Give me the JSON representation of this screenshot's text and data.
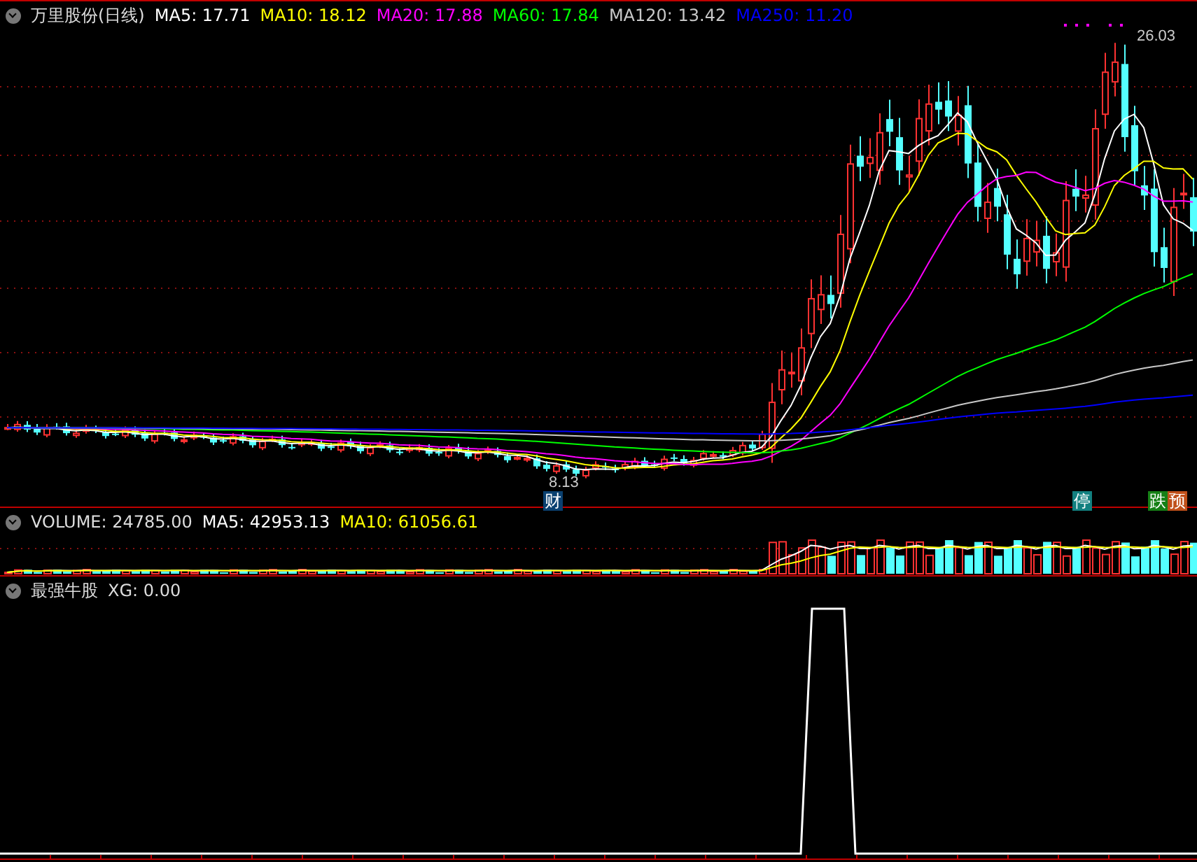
{
  "price_panel": {
    "title": "万里股份(日线)",
    "indicators": [
      {
        "label": "MA5: 17.71",
        "color": "#ffffff"
      },
      {
        "label": "MA10: 18.12",
        "color": "#ffff00"
      },
      {
        "label": "MA20: 17.88",
        "color": "#ff00ff"
      },
      {
        "label": "MA60: 17.84",
        "color": "#00ff00"
      },
      {
        "label": "MA120: 13.42",
        "color": "#c8c8c8"
      },
      {
        "label": "MA250: 11.20",
        "color": "#0000ff"
      }
    ],
    "high_label": "26.03",
    "low_label": "8.13",
    "markers": [
      {
        "text": "财",
        "color": "#0a4070"
      },
      {
        "text": "停",
        "color": "#128080"
      },
      {
        "text": "跌",
        "color": "#168016"
      },
      {
        "text": "预",
        "color": "#c0501a"
      }
    ]
  },
  "volume_panel": {
    "title": "VOLUME: 24785.00",
    "indicators": [
      {
        "label": "MA5: 42953.13",
        "color": "#ffffff"
      },
      {
        "label": "MA10: 61056.61",
        "color": "#ffff00"
      }
    ]
  },
  "indicator_panel": {
    "title": "最强牛股",
    "reading": "XG: 0.00"
  }
}
